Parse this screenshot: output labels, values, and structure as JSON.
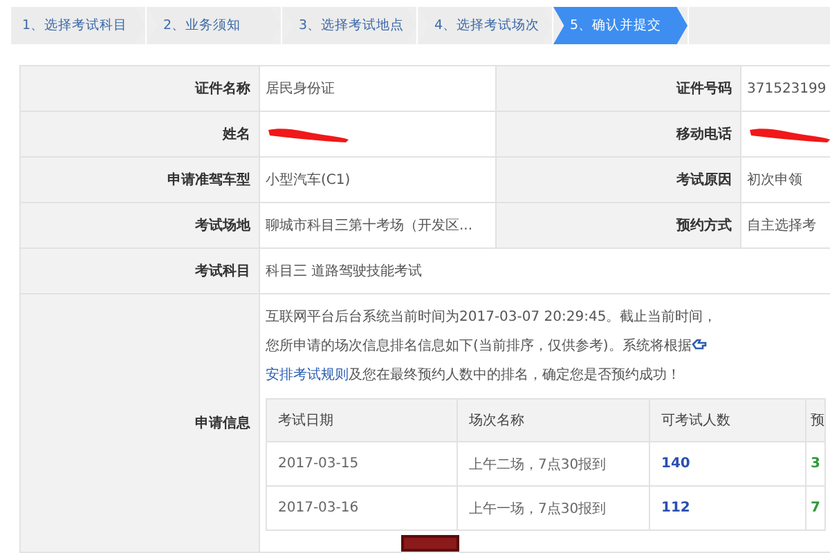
{
  "steps": [
    {
      "label": "1、选择考试科目",
      "selected": false
    },
    {
      "label": "2、业务须知",
      "selected": false
    },
    {
      "label": "3、选择考试地点",
      "selected": false
    },
    {
      "label": "4、选择考试场次",
      "selected": false
    },
    {
      "label": "5、确认并提交",
      "selected": true
    }
  ],
  "fields": [
    {
      "cells": [
        {
          "label": "证件名称",
          "value": "居民身份证"
        },
        {
          "label": "证件号码",
          "value": "371523199"
        }
      ]
    },
    {
      "cells": [
        {
          "label": "姓名",
          "redacted": true
        },
        {
          "label": "移动电话",
          "redacted": true
        }
      ]
    },
    {
      "cells": [
        {
          "label": "申请准驾车型",
          "value": "小型汽车(C1)"
        },
        {
          "label": "考试原因",
          "value": "初次申领"
        }
      ]
    },
    {
      "cells": [
        {
          "label": "考试场地",
          "value": "聊城市科目三第十考场（开发区..."
        },
        {
          "label": "预约方式",
          "value": "自主选择考"
        }
      ]
    },
    {
      "cells": [
        {
          "label": "考试科目",
          "value": "科目三 道路驾驶技能考试"
        }
      ]
    }
  ],
  "application": {
    "label": "申请信息",
    "notice": {
      "lines": [
        "互联网平台后台系统当前时间为2017-03-07 20:29:45。截止当前时间，",
        "您所申请的场次信息排名信息如下(当前排序，仅供参考)。系统将根据"
      ],
      "link": "安排考试规则",
      "tail": "及您在最终预约人数中的排名，确定您是否预约成功！"
    },
    "table": {
      "columns": [
        "考试日期",
        "场次名称",
        "可考试人数",
        "预"
      ],
      "rows": [
        [
          "2017-03-15",
          "上午二场，7点30报到",
          "140",
          "3"
        ],
        [
          "2017-03-16",
          "上午一场，7点30报到",
          "112",
          "7"
        ]
      ]
    }
  },
  "submit": {
    "kind": "button"
  }
}
